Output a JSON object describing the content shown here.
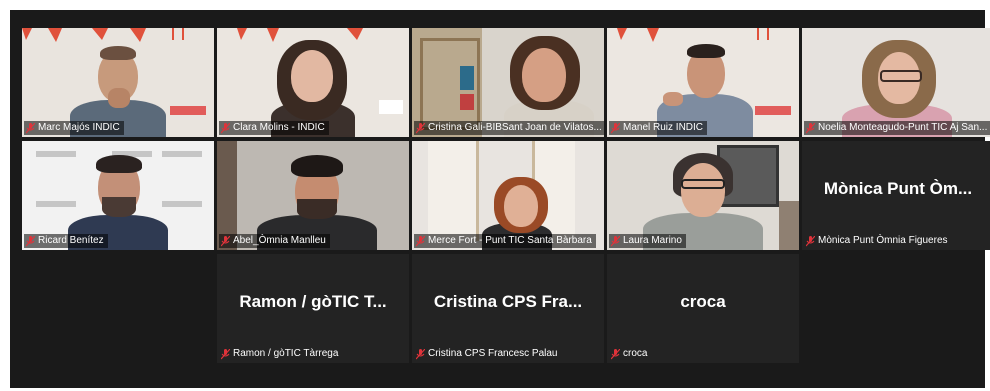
{
  "participants": [
    {
      "name": "Marc Majós INDIC",
      "video": true
    },
    {
      "name": "Clara Molins - INDIC",
      "video": true
    },
    {
      "name": "Cristina Gali-BIBSant Joan de Vilatos...",
      "video": true
    },
    {
      "name": "Manel Ruiz INDIC",
      "video": true,
      "active_speaker": true
    },
    {
      "name": "Noelia Monteagudo-Punt TIC Aj San...",
      "video": true
    },
    {
      "name": "Ricard Benítez",
      "video": true
    },
    {
      "name": "Abel_Òmnia Manlleu",
      "video": true
    },
    {
      "name": "Merce Fort - Punt TIC Santa Bàrbara",
      "video": true
    },
    {
      "name": "Laura Marino",
      "video": true
    },
    {
      "name": "Mònica Punt Òmnia Figueres",
      "video": false,
      "display_name": "Mònica Punt Òm..."
    },
    {
      "name": "Ramon / gòTIC Tàrrega",
      "video": false,
      "display_name": "Ramon / gòTIC T..."
    },
    {
      "name": "Cristina CPS Francesc Palau",
      "video": false,
      "display_name": "Cristina CPS Fra..."
    },
    {
      "name": "croca",
      "video": false,
      "display_name": "croca"
    }
  ],
  "colors": {
    "background": "#1a1a1a",
    "tile": "#232323",
    "active_speaker_border": "#b5d534",
    "muted_mic": "#e0333a"
  },
  "icons": {
    "muted": "mic-muted-icon"
  }
}
